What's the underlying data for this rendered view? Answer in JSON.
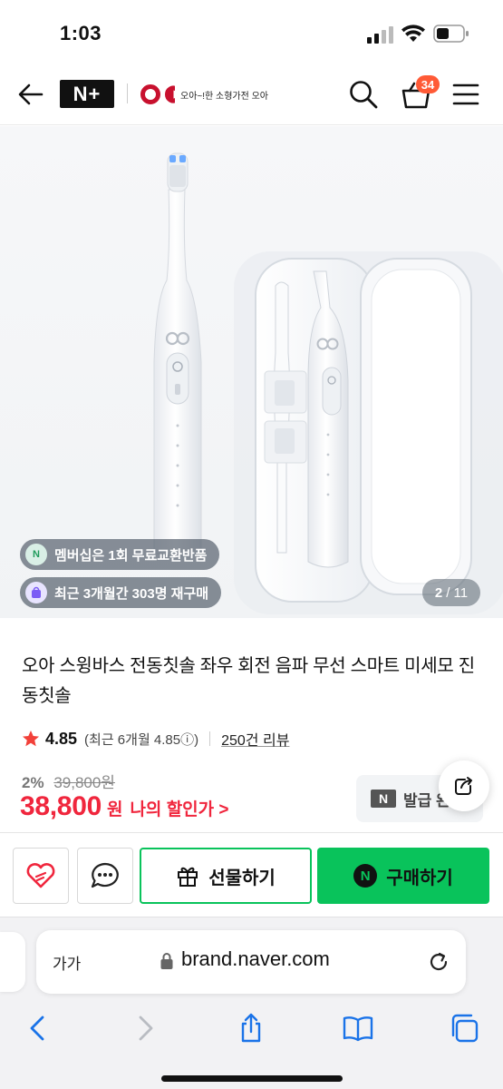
{
  "status": {
    "time": "1:03"
  },
  "header": {
    "store_badge": "N+",
    "brand_tagline": "오아~!한 소형가전 오아",
    "cart_count": "34"
  },
  "gallery": {
    "chip_membership": "멤버십은 1회 무료교환반품",
    "chip_repurchase": "최근 3개월간 303명 재구매",
    "current": "2",
    "total": "/ 11"
  },
  "product": {
    "title": "오아 스윙바스 전동칫솔 좌우 회전 음파 무선 스마트 미세모 진동칫솔",
    "rating": "4.85",
    "rating_sub": "(최근 6개월 4.85ⓘ)",
    "reviews": "250건 리뷰"
  },
  "price": {
    "discount_pct": "2%",
    "original": "39,800원",
    "current": "38,800",
    "unit": "원",
    "my_discount": "나의 할인가 >",
    "coupon": "발급 완료",
    "coupon_badge": "N"
  },
  "actions": {
    "gift": "선물하기",
    "buy": "구매하기",
    "buy_badge": "N"
  },
  "browser": {
    "aa": "가가",
    "url": "brand.naver.com"
  },
  "colors": {
    "naver_green": "#09c35b",
    "price_red": "#f0263d",
    "badge_orange": "#ff5a36"
  }
}
